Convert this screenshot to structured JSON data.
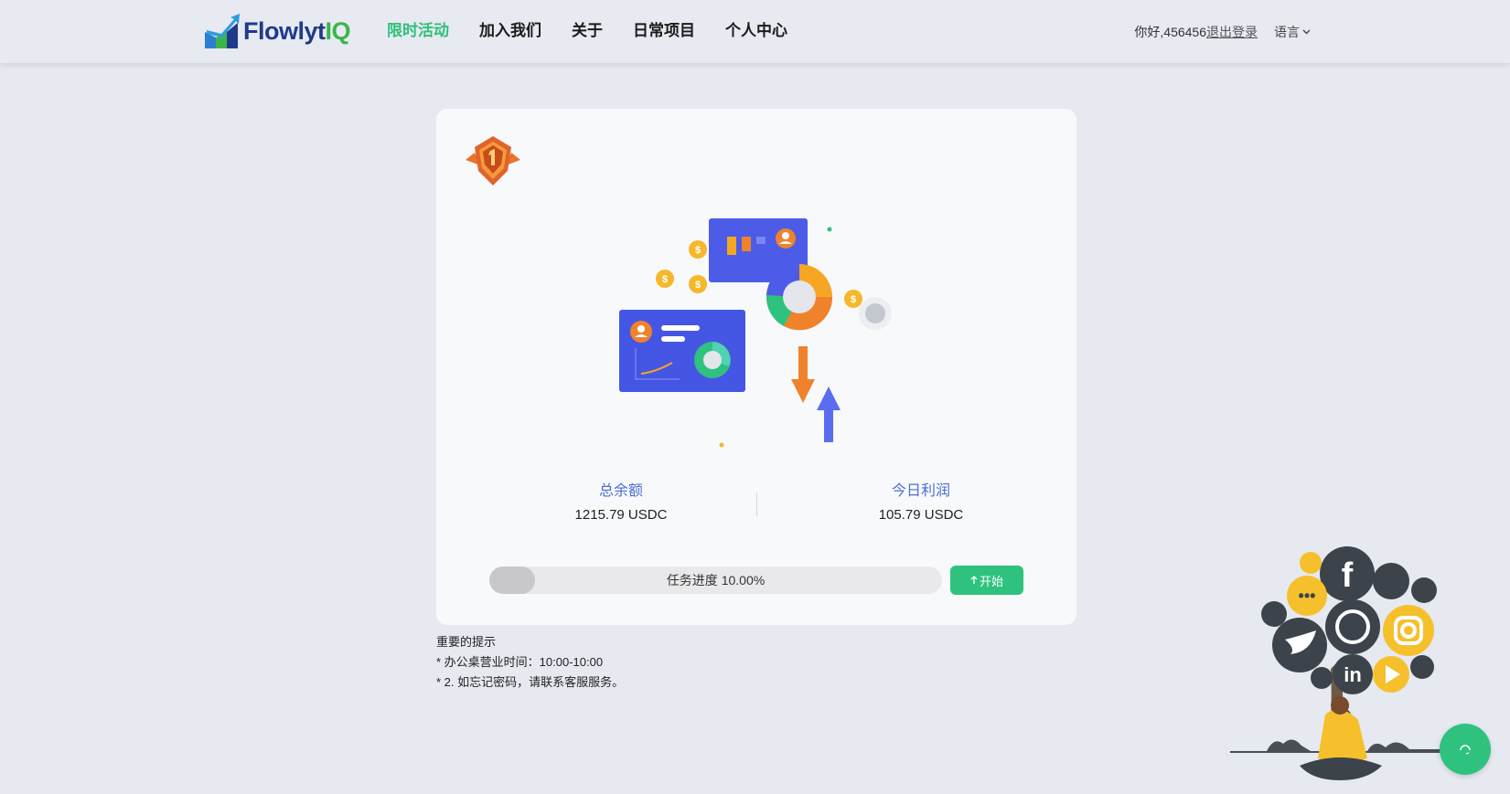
{
  "header": {
    "logo": {
      "text_main": "Flowlyt",
      "text_accent": "IQ"
    },
    "nav": [
      {
        "label": "限时活动",
        "active": true
      },
      {
        "label": "加入我们",
        "active": false
      },
      {
        "label": "关于",
        "active": false
      },
      {
        "label": "日常项目",
        "active": false
      },
      {
        "label": "个人中心",
        "active": false
      }
    ],
    "greeting": "你好,456456",
    "logout_label": "退出登录",
    "language_label": "语言"
  },
  "card": {
    "badge_icon": "rank-badge-icon",
    "stats": {
      "total_balance_label": "总余额",
      "total_balance_value": "1215.79 USDC",
      "today_profit_label": "今日利润",
      "today_profit_value": "105.79 USDC"
    },
    "progress": {
      "label": "任务进度 10.00%",
      "percent": 10
    },
    "start_button_label": "开始"
  },
  "notices": {
    "title": "重要的提示",
    "items": [
      "*  办公桌营业时间：10:00-10:00",
      "*  2. 如忘记密码，请联系客服服务。"
    ]
  },
  "colors": {
    "accent_green": "#2ec27e",
    "stat_label_blue": "#4a6fd1",
    "page_bg": "#e6e9f0"
  }
}
